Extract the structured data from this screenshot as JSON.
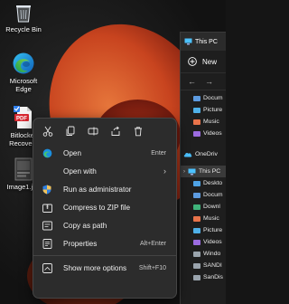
{
  "desktop": {
    "icons": [
      {
        "label": "Recycle Bin",
        "icon": "recycle-bin-icon"
      },
      {
        "label": "Microsoft Edge",
        "icon": "edge-icon"
      },
      {
        "label": "Bitlocker Recove...",
        "icon": "pdf-file-icon"
      },
      {
        "label": "Image1.jpg",
        "icon": "image-file-icon"
      }
    ]
  },
  "explorer": {
    "tab_title": "This PC",
    "new_label": "New",
    "tree_top": [
      {
        "label": "Docum"
      },
      {
        "label": "Picture"
      },
      {
        "label": "Music"
      },
      {
        "label": "Videos"
      }
    ],
    "onedrive": "OneDriv",
    "this_pc": "This PC",
    "tree_pc": [
      {
        "label": "Deskto"
      },
      {
        "label": "Docum"
      },
      {
        "label": "Downl"
      },
      {
        "label": "Music"
      },
      {
        "label": "Picture"
      },
      {
        "label": "Videos"
      },
      {
        "label": "Windo"
      },
      {
        "label": "SANDI"
      },
      {
        "label": "SanDis"
      }
    ]
  },
  "context_menu": {
    "actions": [
      {
        "name": "cut",
        "icon": "cut-icon"
      },
      {
        "name": "copy",
        "icon": "copy-icon"
      },
      {
        "name": "rename",
        "icon": "rename-icon"
      },
      {
        "name": "share",
        "icon": "share-icon"
      },
      {
        "name": "delete",
        "icon": "delete-icon"
      }
    ],
    "items": [
      {
        "label": "Open",
        "shortcut": "Enter",
        "icon": "edge-icon"
      },
      {
        "label": "Open with",
        "shortcut": "",
        "icon": "open-with-icon",
        "submenu": true
      },
      {
        "label": "Run as administrator",
        "shortcut": "",
        "icon": "shield-icon"
      },
      {
        "label": "Compress to ZIP file",
        "shortcut": "",
        "icon": "zip-icon"
      },
      {
        "label": "Copy as path",
        "shortcut": "",
        "icon": "copy-path-icon"
      },
      {
        "label": "Properties",
        "shortcut": "Alt+Enter",
        "icon": "properties-icon"
      },
      {
        "label": "Show more options",
        "shortcut": "Shift+F10",
        "icon": "more-options-icon"
      }
    ]
  },
  "colors": {
    "accent": "#4cc2ff",
    "folder": "#f2c35b",
    "menu_bg": "#2c2c2c",
    "wallpaper_accent": "#d1461f"
  }
}
